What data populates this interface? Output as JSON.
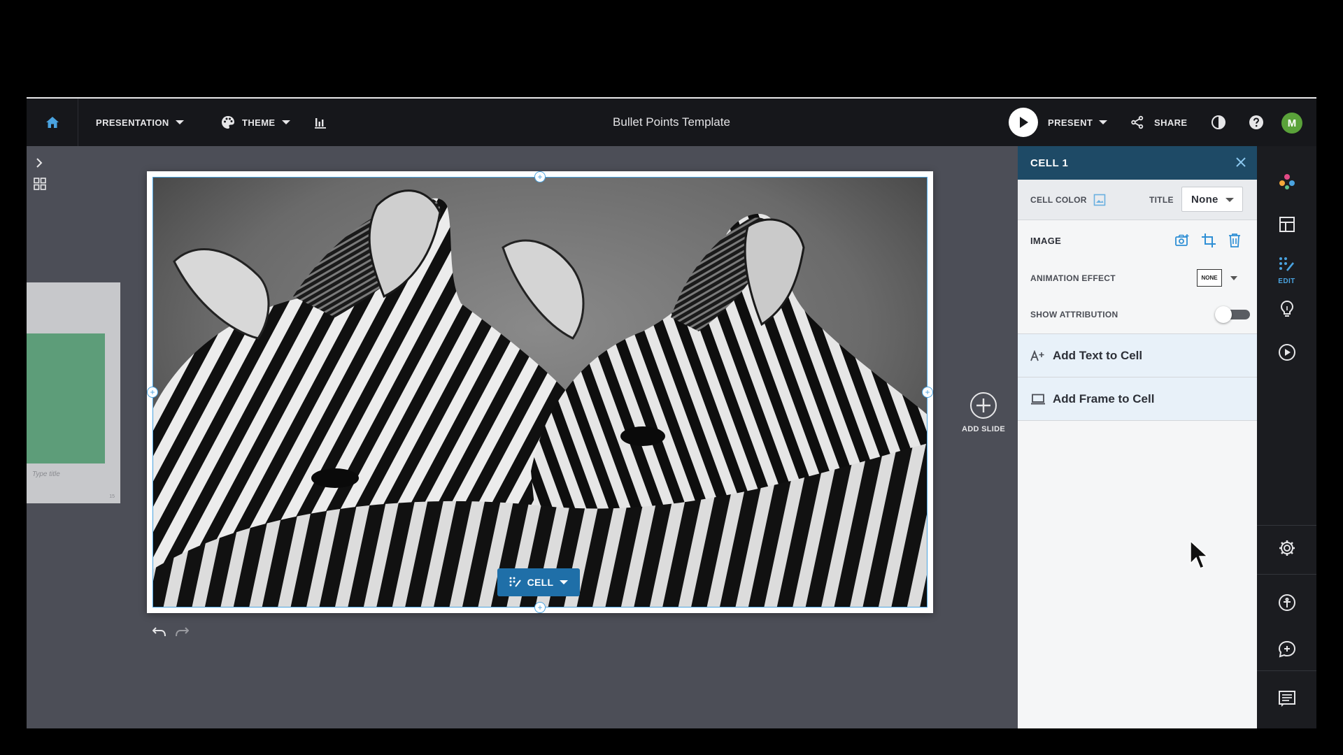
{
  "topbar": {
    "presentation_label": "PRESENTATION",
    "theme_label": "THEME",
    "doc_title": "Bullet Points Template",
    "present_label": "PRESENT",
    "share_label": "SHARE",
    "avatar_letter": "M"
  },
  "thumbnail": {
    "title_placeholder": "Type title",
    "slide_number": "15"
  },
  "slide": {
    "cell_button_label": "CELL"
  },
  "add_slide_label": "ADD SLIDE",
  "panel": {
    "header": "CELL 1",
    "cell_color_label": "CELL COLOR",
    "title_label": "TITLE",
    "title_value": "None",
    "image_label": "IMAGE",
    "animation_label": "ANIMATION EFFECT",
    "animation_value": "NONE",
    "attribution_label": "SHOW ATTRIBUTION",
    "attribution_on": false,
    "add_text_label": "Add Text to Cell",
    "add_frame_label": "Add Frame to Cell"
  },
  "rail": {
    "edit_label": "EDIT"
  },
  "colors": {
    "panel_header": "#1e4a66",
    "accent_blue": "#1f6fa8",
    "avatar_green": "#5aa23a",
    "topbar": "#16171b",
    "workspace": "#4c4e57"
  }
}
